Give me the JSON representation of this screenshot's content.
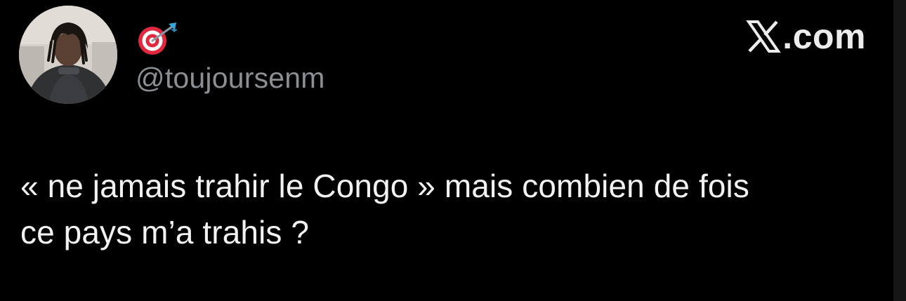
{
  "post": {
    "display_name_emoji": "🎯",
    "handle": "@toujoursenm",
    "text_lines": [
      "« ne jamais trahir le Congo » mais combien de fois",
      "ce pays m’a trahis ?"
    ]
  },
  "brand": {
    "logo": "x-logo-icon",
    "domain_suffix": ".com"
  },
  "colors": {
    "background": "#000000",
    "text": "#f2f2f2",
    "handle": "#8b8f94",
    "dart_red": "#e0283f"
  }
}
